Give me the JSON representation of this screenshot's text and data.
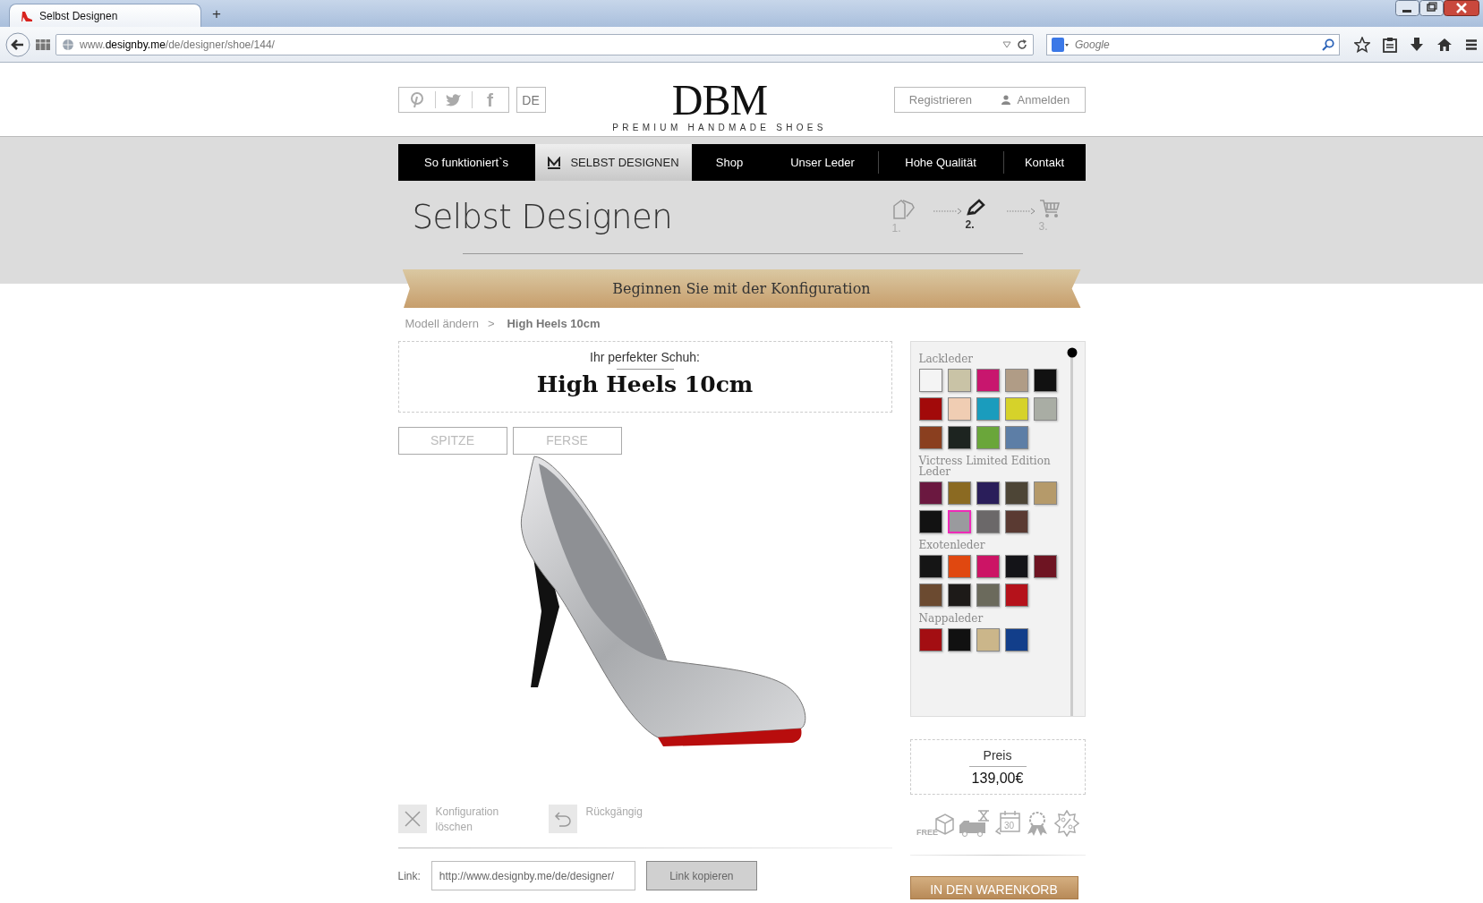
{
  "browser": {
    "tab_title": "Selbst Designen",
    "new_tab": "+",
    "url": "www.**designby.me**/de/designer/shoe/144/",
    "search_placeholder": "Google"
  },
  "header": {
    "social": [
      {
        "kind": "pinterest"
      },
      {
        "kind": "twitter"
      },
      {
        "kind": "facebook",
        "text": "f"
      }
    ],
    "language": "DE",
    "logo": "DBM",
    "tagline": "PREMIUM HANDMADE SHOES",
    "account": [
      {
        "kind": "register",
        "label": "Registrieren"
      },
      {
        "kind": "login",
        "label": "Anmelden"
      }
    ]
  },
  "nav": [
    {
      "label": "So funktioniert`s",
      "selected": false
    },
    {
      "label": "SELBST DESIGNEN",
      "selected": true
    },
    {
      "label": "Shop",
      "selected": false
    },
    {
      "label": "Unser Leder",
      "selected": false
    },
    {
      "label": "Hohe Qualität",
      "selected": false
    },
    {
      "label": "Kontakt",
      "selected": false
    }
  ],
  "page_title": "Selbst Designen",
  "steps": [
    {
      "kind": "model",
      "label": "1.",
      "selected": false
    },
    {
      "kind": "design",
      "label": "2.",
      "selected": true
    },
    {
      "kind": "cart",
      "label": "3.",
      "selected": false
    }
  ],
  "ribbon": "Beginnen Sie mit der Konfiguration",
  "breadcrumb": {
    "link": "Modell ändern",
    "separator": ">",
    "current": "High Heels 10cm"
  },
  "product": {
    "label": "Ihr perfekter Schuh:",
    "name": "High Heels 10cm"
  },
  "view_tabs": [
    "SPITZE",
    "FERSE"
  ],
  "actions": [
    {
      "kind": "clear",
      "label": "Konfiguration löschen"
    },
    {
      "kind": "undo",
      "label": "Rückgängig"
    }
  ],
  "share": {
    "label": "Link:",
    "value": "http://www.designby.me/de/designer/",
    "button": "Link kopieren"
  },
  "materials": [
    {
      "name": "Lackleder",
      "swatches": [
        {
          "color": "#f4f4f4",
          "selected": false
        },
        {
          "color": "#c9c3a6",
          "selected": false
        },
        {
          "color": "#c8166e",
          "selected": false
        },
        {
          "color": "#b09c86",
          "selected": false
        },
        {
          "color": "#111111",
          "selected": false
        },
        {
          "color": "#a20a0a",
          "selected": false
        },
        {
          "color": "#f0cdb3",
          "selected": false
        },
        {
          "color": "#1a9cbd",
          "selected": false
        },
        {
          "color": "#d6d22a",
          "selected": false
        },
        {
          "color": "#a9ada4",
          "selected": false
        },
        {
          "color": "#8a3f1f",
          "selected": false
        },
        {
          "color": "#1d2420",
          "selected": false
        },
        {
          "color": "#6aa63a",
          "selected": false
        },
        {
          "color": "#5d7ea6",
          "selected": false
        }
      ]
    },
    {
      "name": "Victress Limited Edition Leder",
      "swatches": [
        {
          "color": "#6b1840",
          "selected": false
        },
        {
          "color": "#8b6a22",
          "selected": false
        },
        {
          "color": "#2a1e5a",
          "selected": false
        },
        {
          "color": "#4d4536",
          "selected": false
        },
        {
          "color": "#b59a6a",
          "selected": false
        },
        {
          "color": "#121212",
          "selected": false
        },
        {
          "color": "#9a9a9e",
          "selected": true
        },
        {
          "color": "#6b6869",
          "selected": false
        },
        {
          "color": "#5a3a32",
          "selected": false
        }
      ]
    },
    {
      "name": "Exotenleder",
      "swatches": [
        {
          "color": "#151515",
          "selected": false
        },
        {
          "color": "#e04810",
          "selected": false
        },
        {
          "color": "#cc1465",
          "selected": false
        },
        {
          "color": "#141418",
          "selected": false
        },
        {
          "color": "#6e1422",
          "selected": false
        },
        {
          "color": "#6b4a30",
          "selected": false
        },
        {
          "color": "#1d1a18",
          "selected": false
        },
        {
          "color": "#6b6a5c",
          "selected": false
        },
        {
          "color": "#b5121b",
          "selected": false
        }
      ]
    },
    {
      "name": "Nappaleder",
      "swatches": [
        {
          "color": "#a30e12",
          "selected": false
        },
        {
          "color": "#111111",
          "selected": false
        },
        {
          "color": "#cbb68a",
          "selected": false
        },
        {
          "color": "#123e8a",
          "selected": false
        }
      ]
    }
  ],
  "price": {
    "label": "Preis",
    "value": "139,00€"
  },
  "trust_badges": [
    {
      "kind": "free-shipping",
      "text": "FREE"
    },
    {
      "kind": "express"
    },
    {
      "kind": "returns",
      "text": "30"
    },
    {
      "kind": "quality"
    },
    {
      "kind": "discount"
    }
  ],
  "cart_button": "IN DEN WARENKORB"
}
